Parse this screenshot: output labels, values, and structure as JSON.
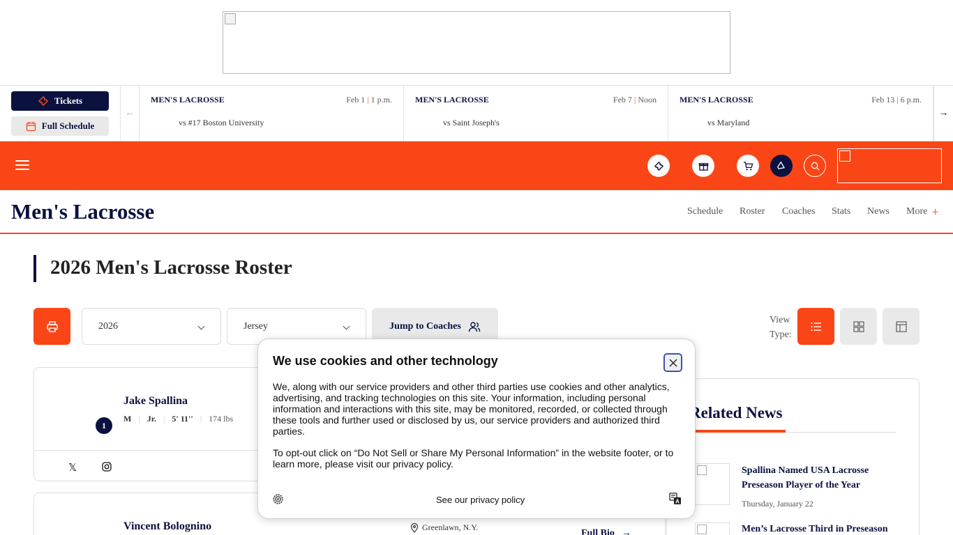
{
  "scoreboard": {
    "tickets_label": "Tickets",
    "schedule_label": "Full Schedule",
    "games": [
      {
        "sport": "MEN'S LACROSSE",
        "date": "Feb 1",
        "time": "1 p.m.",
        "opponent": "vs #17 Boston University"
      },
      {
        "sport": "MEN'S LACROSSE",
        "date": "Feb 7",
        "time": "Noon",
        "opponent": "vs Saint Joseph's"
      },
      {
        "sport": "MEN'S LACROSSE",
        "date": "Feb 13",
        "time": "6 p.m.",
        "opponent": "vs Maryland"
      }
    ]
  },
  "section": {
    "title": "Men's Lacrosse",
    "links": [
      "Schedule",
      "Roster",
      "Coaches",
      "Stats",
      "News",
      "More"
    ]
  },
  "page": {
    "title": "2026 Men's Lacrosse Roster"
  },
  "controls": {
    "season_value": "2026",
    "sort_value": "Jersey",
    "jump_label": "Jump to Coaches",
    "view_type_label_1": "View",
    "view_type_label_2": "Type:"
  },
  "roster": [
    {
      "name": "Jake Spallina",
      "number": "1",
      "position": "M",
      "year": "Jr.",
      "height": "5' 11''",
      "weight": "174 lbs"
    },
    {
      "name": "Vincent Bolognino",
      "hometown": "Greenlawn, N.Y.",
      "bio_label": "Full Bio"
    }
  ],
  "related_news": {
    "title": "Related News",
    "items": [
      {
        "headline": "Spallina Named USA Lacrosse Preseason Player of the Year",
        "date": "Thursday, January 22"
      },
      {
        "headline": "Men’s Lacrosse Third in Preseason"
      }
    ]
  },
  "cookie": {
    "title": "We use cookies and other technology",
    "paragraph1": "We, along with our service providers and other third parties use cookies and other analytics, advertising, and tracking technologies on this site. Your information, including personal information and interactions with this site, may be monitored, recorded, or collected through these tools and further used or disclosed by us, our service providers and authorized third parties.",
    "paragraph2": "To opt-out click on “Do Not Sell or Share My Personal Information” in the website footer, or to learn more, please visit our privacy policy.",
    "privacy_link": "See our privacy policy"
  },
  "colors": {
    "brand_orange": "#fa4616",
    "navy": "#0b1240"
  }
}
